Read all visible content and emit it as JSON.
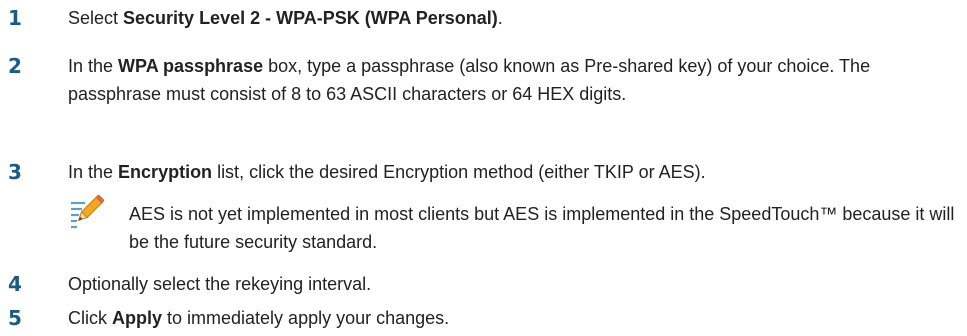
{
  "steps": [
    {
      "number": "1",
      "pre": "Select ",
      "bold": "Security Level 2 - WPA-PSK (WPA Personal)",
      "post": "."
    },
    {
      "number": "2",
      "pre": "In the ",
      "bold": "WPA passphrase",
      "post": " box, type a passphrase (also known as Pre-shared key) of your choice. The passphrase must consist of 8 to 63 ASCII characters or 64 HEX digits."
    },
    {
      "number": "3",
      "pre": "In the ",
      "bold": "Encryption",
      "post": " list, click the desired Encryption method (either TKIP or AES)."
    },
    {
      "number": "4",
      "text": "Optionally select the rekeying interval."
    },
    {
      "number": "5",
      "pre": "Click ",
      "bold": "Apply",
      "post": " to immediately apply your changes."
    }
  ],
  "note": {
    "icon": "note-pencil-icon",
    "text": "AES is not yet implemented in most clients but AES is implemented in the SpeedTouch™ because it will be the future security standard."
  },
  "colors": {
    "step_number": "#1b5a86",
    "body_text": "#222222",
    "icon_accent": "#f5a623"
  }
}
